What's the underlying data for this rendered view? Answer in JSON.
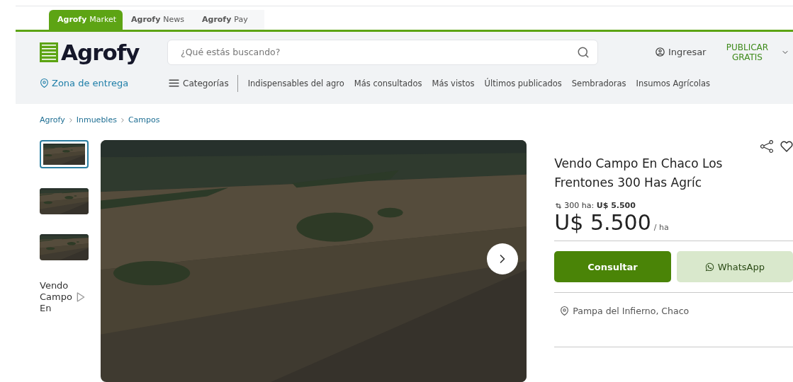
{
  "site_tabs": [
    {
      "brand": "Agrofy",
      "label": "Market",
      "selected": true
    },
    {
      "brand": "Agrofy",
      "label": "News",
      "selected": false
    },
    {
      "brand": "Agrofy",
      "label": "Pay",
      "selected": false
    }
  ],
  "header": {
    "logo": "Agrofy",
    "search": {
      "placeholder": "¿Qué estás buscando?"
    },
    "login": "Ingresar",
    "publish": "PUBLICAR GRATIS"
  },
  "nav": {
    "delivery_zone": "Zona de entrega",
    "categories": "Categorías",
    "links": [
      "Indispensables del agro",
      "Más consultados",
      "Más vistos",
      "Últimos publicados",
      "Sembradoras",
      "Insumos Agrícolas"
    ]
  },
  "breadcrumb": [
    "Agrofy",
    "Inmuebles",
    "Campos"
  ],
  "gallery": {
    "thumbnails": [
      {
        "kind": "picture",
        "selected": true
      },
      {
        "kind": "picture",
        "selected": false
      },
      {
        "kind": "picture",
        "selected": false
      },
      {
        "kind": "video",
        "alt": "Vendo Campo En",
        "selected": false
      }
    ]
  },
  "listing": {
    "title": "Vendo Campo En Chaco Los Frentones 300 Has Agríc",
    "area_price": "300 ha: **U$ 5.500**",
    "price": "U$ 5.500",
    "price_unit": "/ ha",
    "buttons": [
      {
        "kind": "primary",
        "label": "Consultar"
      },
      {
        "kind": "whatsapp",
        "label": "WhatsApp"
      }
    ],
    "location": "Pampa del Infierno, Chaco"
  }
}
